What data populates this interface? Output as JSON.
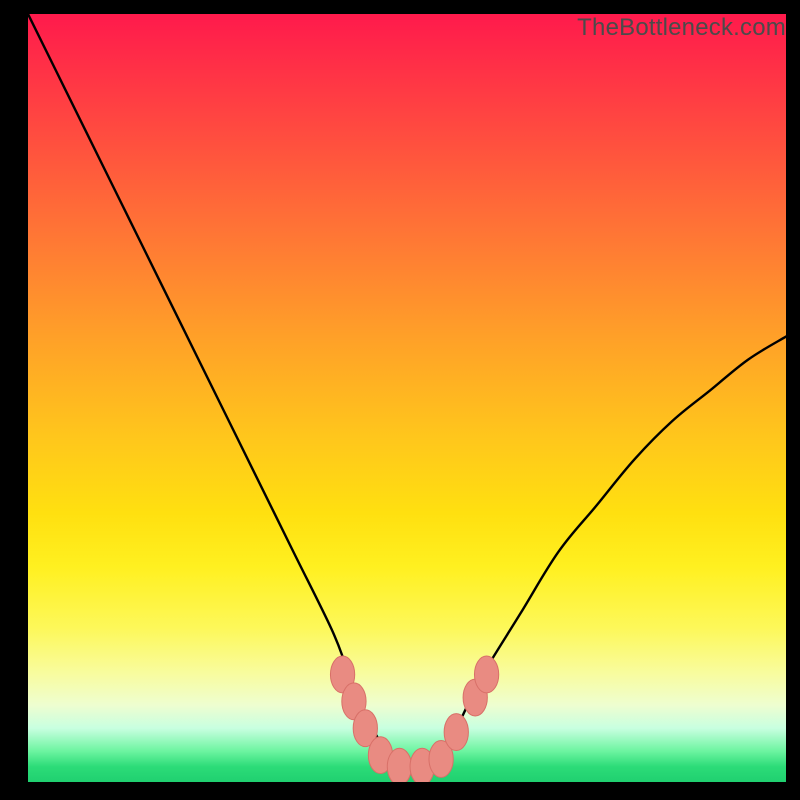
{
  "watermark": "TheBottleneck.com",
  "colors": {
    "curve_stroke": "#000000",
    "marker_fill": "#e98b82",
    "marker_stroke": "#d87068",
    "frame": "#000000"
  },
  "chart_data": {
    "type": "line",
    "title": "",
    "xlabel": "",
    "ylabel": "",
    "xlim": [
      0,
      100
    ],
    "ylim": [
      0,
      100
    ],
    "series": [
      {
        "name": "bottleneck-curve",
        "x": [
          0,
          5,
          10,
          15,
          20,
          25,
          30,
          35,
          40,
          42,
          44,
          46,
          48,
          50,
          52,
          54,
          56,
          58,
          60,
          65,
          70,
          75,
          80,
          85,
          90,
          95,
          100
        ],
        "y": [
          100,
          90,
          80,
          70,
          60,
          50,
          40,
          30,
          20,
          15,
          10,
          6,
          3,
          2,
          2,
          3,
          6,
          10,
          14,
          22,
          30,
          36,
          42,
          47,
          51,
          55,
          58
        ]
      }
    ],
    "markers": [
      {
        "x": 41.5,
        "y": 14.0
      },
      {
        "x": 43.0,
        "y": 10.5
      },
      {
        "x": 44.5,
        "y": 7.0
      },
      {
        "x": 46.5,
        "y": 3.5
      },
      {
        "x": 49.0,
        "y": 2.0
      },
      {
        "x": 52.0,
        "y": 2.0
      },
      {
        "x": 54.5,
        "y": 3.0
      },
      {
        "x": 56.5,
        "y": 6.5
      },
      {
        "x": 59.0,
        "y": 11.0
      },
      {
        "x": 60.5,
        "y": 14.0
      }
    ],
    "marker_rx": 1.6,
    "marker_ry": 2.4
  }
}
